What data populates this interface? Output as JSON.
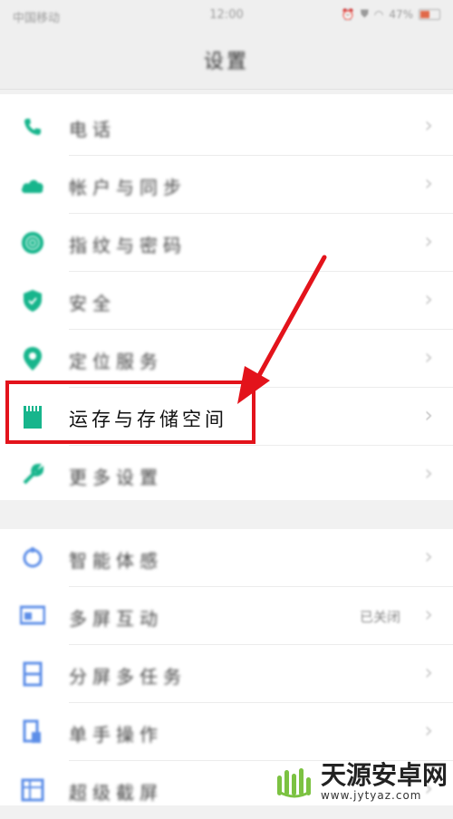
{
  "status_bar": {
    "carrier": "中国移动",
    "time": "12:00",
    "battery": "47%"
  },
  "header": {
    "title": "设置"
  },
  "group1": [
    {
      "label": "电话",
      "icon": "phone-icon"
    },
    {
      "label": "帐户与同步",
      "icon": "cloud-icon"
    },
    {
      "label": "指纹与密码",
      "icon": "fingerprint-icon"
    },
    {
      "label": "安全",
      "icon": "shield-icon"
    },
    {
      "label": "定位服务",
      "icon": "location-pin-icon"
    },
    {
      "label": "运存与存储空间",
      "icon": "sd-card-icon"
    },
    {
      "label": "更多设置",
      "icon": "wrench-icon"
    }
  ],
  "group2": [
    {
      "label": "智能体感",
      "icon": "motion-icon"
    },
    {
      "label": "多屏互动",
      "icon": "screen-cast-icon",
      "value": "已关闭"
    },
    {
      "label": "分屏多任务",
      "icon": "split-screen-icon"
    },
    {
      "label": "单手操作",
      "icon": "one-hand-icon"
    },
    {
      "label": "超级截屏",
      "icon": "screenshot-icon"
    }
  ],
  "watermark": {
    "title": "天源安卓网",
    "url": "www.jytyaz.com"
  },
  "colors": {
    "accent_green": "#17b58c",
    "accent_blue": "#5d8ee8",
    "highlight_red": "#e3131b"
  }
}
